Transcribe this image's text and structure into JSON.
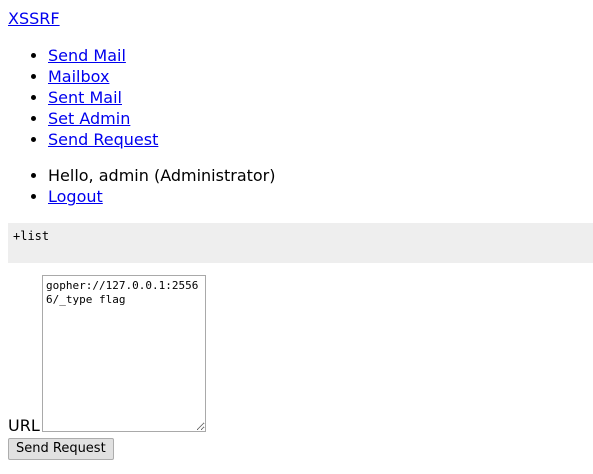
{
  "brand": "XSSRF",
  "nav": {
    "items": [
      {
        "label": "Send Mail"
      },
      {
        "label": "Mailbox"
      },
      {
        "label": "Sent Mail"
      },
      {
        "label": "Set Admin"
      },
      {
        "label": "Send Request"
      }
    ]
  },
  "user": {
    "greeting": "Hello, admin (Administrator)",
    "logout_label": "Logout"
  },
  "output": {
    "text": "+list"
  },
  "form": {
    "url_label": "URL",
    "url_value": "gopher://127.0.0.1:25566/_type flag",
    "submit_label": "Send Request"
  }
}
